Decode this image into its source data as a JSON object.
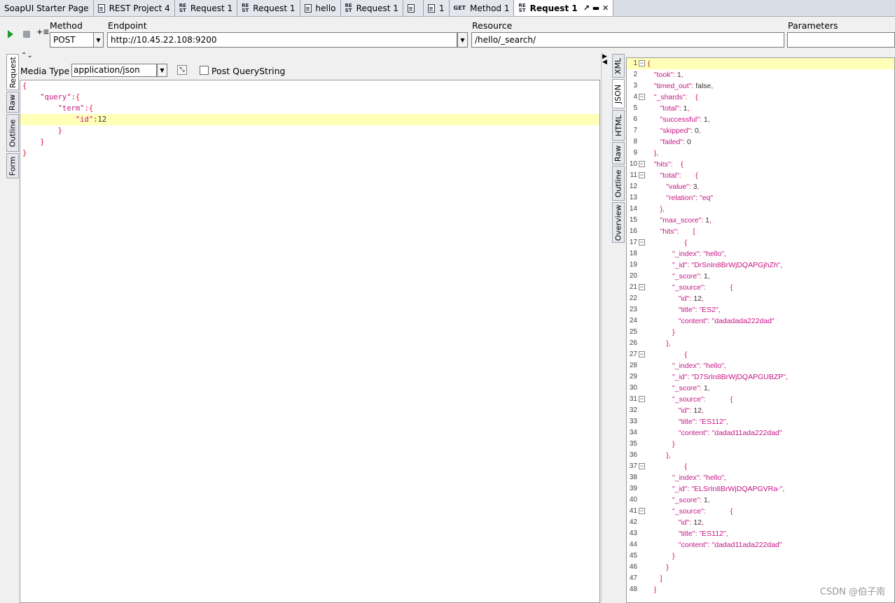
{
  "tabs": [
    {
      "label": "SoapUI Starter Page",
      "icon": "",
      "active": false
    },
    {
      "label": "REST Project 4",
      "icon": "doc",
      "active": false
    },
    {
      "label": "Request 1",
      "icon": "REST",
      "active": false
    },
    {
      "label": "Request 1",
      "icon": "REST",
      "active": false
    },
    {
      "label": "hello",
      "icon": "doc",
      "active": false
    },
    {
      "label": "Request 1",
      "icon": "REST",
      "active": false
    },
    {
      "label": "",
      "icon": "doc",
      "active": false
    },
    {
      "label": "1",
      "icon": "doc",
      "active": false
    },
    {
      "label": "Method 1",
      "icon": "GET",
      "active": false
    },
    {
      "label": "Request 1",
      "icon": "REST",
      "active": true
    }
  ],
  "toolbar": {
    "method_label": "Method",
    "method_value": "POST",
    "endpoint_label": "Endpoint",
    "endpoint_value": "http://10.45.22.108:9200",
    "resource_label": "Resource",
    "resource_value": "/hello/_search/",
    "parameters_label": "Parameters",
    "parameters_value": ""
  },
  "request": {
    "side_tabs": [
      "Request",
      "Raw",
      "Outline",
      "Form"
    ],
    "media_type_label": "Media Type",
    "media_type_value": "application/json",
    "post_querystring_label": "Post QueryString",
    "body_lines": [
      "{",
      "    \"query\":{",
      "        \"term\":{",
      "            \"id\":12",
      "        }",
      "    }",
      "}"
    ],
    "highlight_line": 3
  },
  "response": {
    "side_tabs": [
      "XML",
      "JSON",
      "HTML",
      "Raw",
      "Outline",
      "Overview"
    ],
    "lines": [
      {
        "n": "1",
        "f": true,
        "t": "{"
      },
      {
        "n": "2",
        "f": false,
        "t": "   \"took\": 1,"
      },
      {
        "n": "3",
        "f": false,
        "t": "   \"timed_out\": false,"
      },
      {
        "n": "4",
        "f": true,
        "t": "   \"_shards\":    {"
      },
      {
        "n": "5",
        "f": false,
        "t": "      \"total\": 1,"
      },
      {
        "n": "6",
        "f": false,
        "t": "      \"successful\": 1,"
      },
      {
        "n": "7",
        "f": false,
        "t": "      \"skipped\": 0,"
      },
      {
        "n": "8",
        "f": false,
        "t": "      \"failed\": 0"
      },
      {
        "n": "9",
        "f": false,
        "t": "   },"
      },
      {
        "n": "10",
        "f": true,
        "t": "   \"hits\":    {"
      },
      {
        "n": "11",
        "f": true,
        "t": "      \"total\":       {"
      },
      {
        "n": "12",
        "f": false,
        "t": "         \"value\": 3,"
      },
      {
        "n": "13",
        "f": false,
        "t": "         \"relation\": \"eq\""
      },
      {
        "n": "14",
        "f": false,
        "t": "      },"
      },
      {
        "n": "15",
        "f": false,
        "t": "      \"max_score\": 1,"
      },
      {
        "n": "16",
        "f": false,
        "t": "      \"hits\":       ["
      },
      {
        "n": "17",
        "f": true,
        "t": "                  {"
      },
      {
        "n": "18",
        "f": false,
        "t": "            \"_index\": \"hello\","
      },
      {
        "n": "19",
        "f": false,
        "t": "            \"_id\": \"DrSnIn8BrWjDQAPGjhZh\","
      },
      {
        "n": "20",
        "f": false,
        "t": "            \"_score\": 1,"
      },
      {
        "n": "21",
        "f": true,
        "t": "            \"_source\":            {"
      },
      {
        "n": "22",
        "f": false,
        "t": "               \"id\": 12,"
      },
      {
        "n": "23",
        "f": false,
        "t": "               \"title\": \"ES2\","
      },
      {
        "n": "24",
        "f": false,
        "t": "               \"content\": \"dadadada222dad\""
      },
      {
        "n": "25",
        "f": false,
        "t": "            }"
      },
      {
        "n": "26",
        "f": false,
        "t": "         },"
      },
      {
        "n": "27",
        "f": true,
        "t": "                  {"
      },
      {
        "n": "28",
        "f": false,
        "t": "            \"_index\": \"hello\","
      },
      {
        "n": "29",
        "f": false,
        "t": "            \"_id\": \"D7SrIn8BrWjDQAPGUBZP\","
      },
      {
        "n": "30",
        "f": false,
        "t": "            \"_score\": 1,"
      },
      {
        "n": "31",
        "f": true,
        "t": "            \"_source\":            {"
      },
      {
        "n": "32",
        "f": false,
        "t": "               \"id\": 12,"
      },
      {
        "n": "33",
        "f": false,
        "t": "               \"title\": \"ES112\","
      },
      {
        "n": "34",
        "f": false,
        "t": "               \"content\": \"dadad11ada222dad\""
      },
      {
        "n": "35",
        "f": false,
        "t": "            }"
      },
      {
        "n": "36",
        "f": false,
        "t": "         },"
      },
      {
        "n": "37",
        "f": true,
        "t": "                  {"
      },
      {
        "n": "38",
        "f": false,
        "t": "            \"_index\": \"hello\","
      },
      {
        "n": "39",
        "f": false,
        "t": "            \"_id\": \"ELSrIn8BrWjDQAPGVRa-\","
      },
      {
        "n": "40",
        "f": false,
        "t": "            \"_score\": 1,"
      },
      {
        "n": "41",
        "f": true,
        "t": "            \"_source\":            {"
      },
      {
        "n": "42",
        "f": false,
        "t": "               \"id\": 12,"
      },
      {
        "n": "43",
        "f": false,
        "t": "               \"title\": \"ES112\","
      },
      {
        "n": "44",
        "f": false,
        "t": "               \"content\": \"dadad11ada222dad\""
      },
      {
        "n": "45",
        "f": false,
        "t": "            }"
      },
      {
        "n": "46",
        "f": false,
        "t": "         }"
      },
      {
        "n": "47",
        "f": false,
        "t": "      ]"
      },
      {
        "n": "48",
        "f": false,
        "t": "   }"
      }
    ]
  },
  "watermark": "CSDN @伯子南",
  "colors": {
    "key": "#c71585",
    "brace": "#e0103a",
    "highlight": "#ffffb8"
  }
}
